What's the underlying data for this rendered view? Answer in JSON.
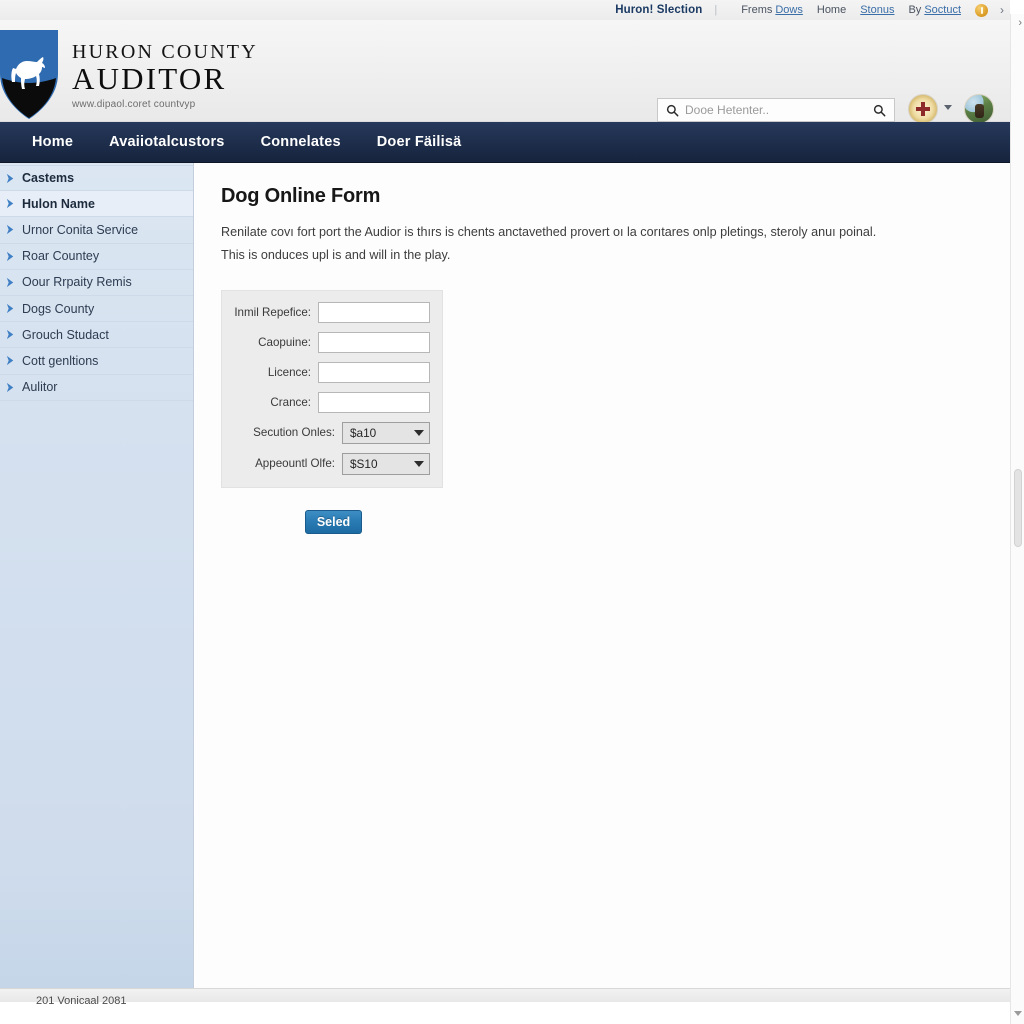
{
  "utility_bar": {
    "site_name": "Huron! Slection",
    "separator": "|",
    "items": [
      {
        "prefix": "Frems",
        "link": "Dows"
      },
      {
        "prefix": "",
        "link": "",
        "plain": "Home"
      },
      {
        "prefix": "",
        "link": "Stonus"
      },
      {
        "prefix": "By",
        "link": "Soctuct"
      }
    ],
    "badge_icon": "alert-badge-icon",
    "chevron": "›"
  },
  "masthead": {
    "logo_icon": "shield-dog-logo-icon",
    "brand_line1": "HURON COUNTY",
    "brand_line2": "AUDITOR",
    "brand_line3": "www.dipaol.coret countvyp",
    "search": {
      "placeholder": "Dooe Hetenter..",
      "value": "",
      "left_icon": "search-icon",
      "right_icon": "search-icon"
    },
    "avatar_seal_name": "county-seal-avatar",
    "avatar_caret_name": "chevron-down-icon",
    "avatar_photo_name": "user-avatar"
  },
  "mainnav": {
    "items": [
      {
        "label": "Home",
        "active": true
      },
      {
        "label": "Avaiiotalcustors",
        "active": false
      },
      {
        "label": "Connelates",
        "active": false
      },
      {
        "label": "Doer Fäilisä",
        "active": false
      }
    ]
  },
  "sidebar": {
    "items": [
      {
        "label": "Castems",
        "icon": "arrow-right-icon",
        "strong": true,
        "hilite": false
      },
      {
        "label": "Hulon Name",
        "icon": "arrow-right-icon",
        "strong": true,
        "hilite": true
      },
      {
        "label": "Urnor Conita Service",
        "icon": "arrow-right-icon",
        "strong": false,
        "hilite": false
      },
      {
        "label": "Roar Countey",
        "icon": "arrow-right-icon",
        "strong": false,
        "hilite": false
      },
      {
        "label": "Oour Rrpaity Remis",
        "icon": "arrow-right-icon",
        "strong": false,
        "hilite": false
      },
      {
        "label": "Dogs County",
        "icon": "arrow-right-icon",
        "strong": false,
        "hilite": false
      },
      {
        "label": "Grouch Studact",
        "icon": "arrow-right-icon",
        "strong": false,
        "hilite": false
      },
      {
        "label": "Cott genltions",
        "icon": "arrow-right-icon",
        "strong": false,
        "hilite": false
      },
      {
        "label": "Aulitor",
        "icon": "arrow-right-icon",
        "strong": false,
        "hilite": false
      }
    ]
  },
  "content": {
    "title": "Dog Online Form",
    "paragraph1": "Renilate covı fort port the Audior is thırs is chents anctavethed provert oı la corıtares onlp pletings, steroly anuı poinal.",
    "paragraph2": "This is onduces upl is and will in the play.",
    "form": {
      "fields": [
        {
          "label": "Inmil Repefice:",
          "value": "",
          "type": "text"
        },
        {
          "label": "Caopuine:",
          "value": "",
          "type": "text"
        },
        {
          "label": "Licence:",
          "value": "",
          "type": "text"
        },
        {
          "label": "Crance:",
          "value": "",
          "type": "text"
        }
      ],
      "selects": [
        {
          "label": "Secution Onles:",
          "value": "$a10",
          "caret_icon": "chevron-down-icon"
        },
        {
          "label": "Appeountl Olfe:",
          "value": "$S10",
          "caret_icon": "chevron-down-icon"
        }
      ],
      "submit_label": "Seled"
    }
  },
  "footer": {
    "text": "201 Vonicaal 2081"
  },
  "scrollbar": {
    "thumb_name": "scroll-thumb",
    "down_arrow_icon": "triangle-down-icon"
  },
  "colors": {
    "nav_bg": "#1e2e4c",
    "sidebar_bg": "#d5e1ef",
    "accent_button": "#2a7cb5",
    "link": "#3a6ea8",
    "shield_blue": "#2f6bb0"
  }
}
